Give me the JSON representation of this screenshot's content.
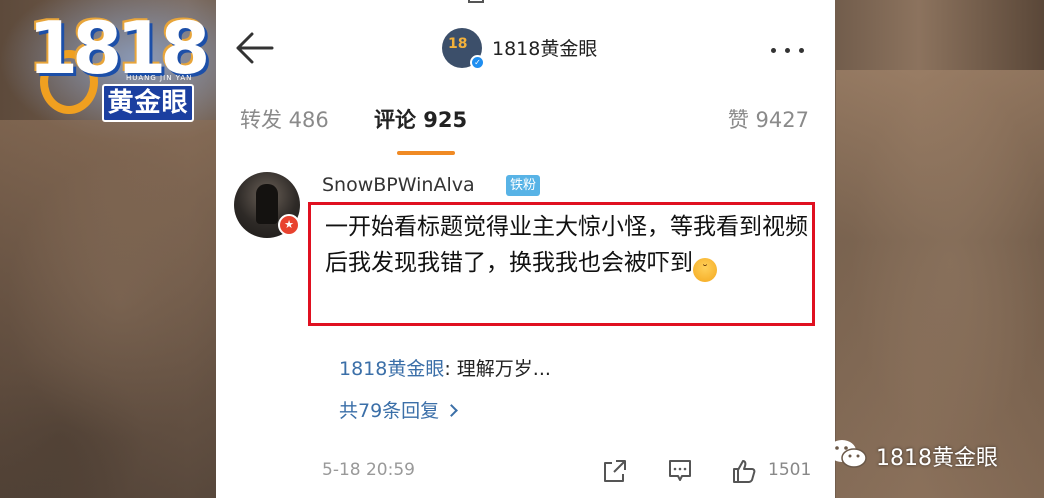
{
  "tv_logo": {
    "number": "1818",
    "sub": "HUANG JIN YAN",
    "badge": "黄金眼"
  },
  "header": {
    "account_name": "1818黄金眼"
  },
  "tabs": [
    {
      "label": "转发 486"
    },
    {
      "label": "评论 925"
    },
    {
      "label": "赞 9427"
    }
  ],
  "comment": {
    "username": "SnowBPWinAlva",
    "fan_badge": "铁粉",
    "text": "一开始看标题觉得业主大惊小怪，等我看到视频后我发现我错了，换我我也会被吓到",
    "reply_author": "1818黄金眼",
    "reply_text": ": 理解万岁...",
    "reply_count": "共79条回复",
    "time": "5-18 20:59",
    "like_count": "1501"
  },
  "watermark": {
    "text": "1818黄金眼"
  },
  "colors": {
    "accent_orange": "#f08a24",
    "highlight_red": "#e01020",
    "link_blue": "#3b6fa8"
  }
}
